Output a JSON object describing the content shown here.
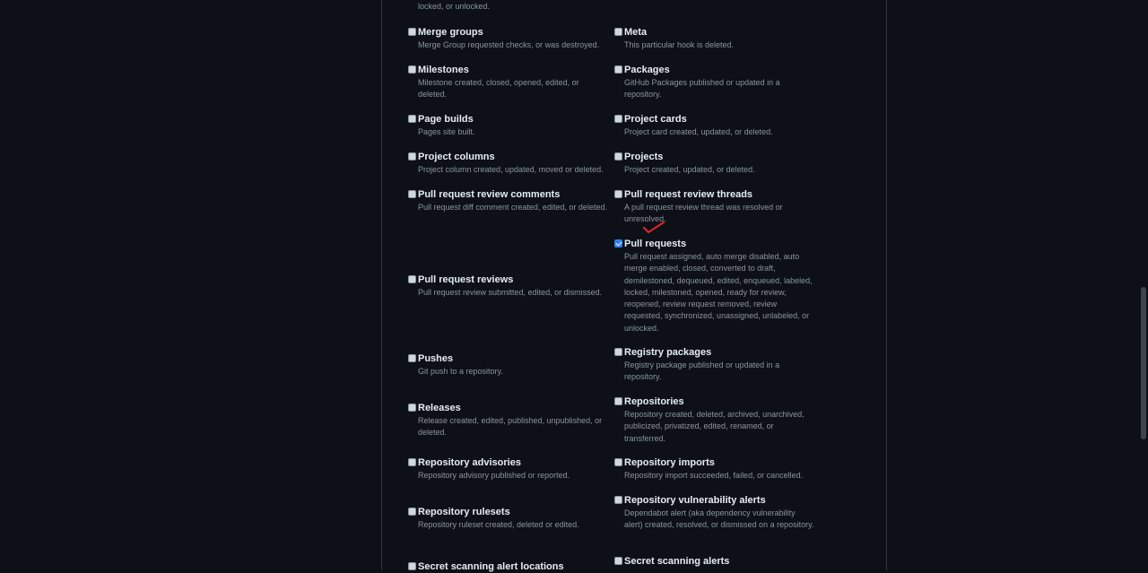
{
  "top_text": "locked, or unlocked.",
  "events": [
    {
      "title": "Merge groups",
      "desc": "Merge Group requested checks, or was destroyed.",
      "checked": false
    },
    {
      "title": "Meta",
      "desc": "This particular hook is deleted.",
      "checked": false
    },
    {
      "title": "Milestones",
      "desc": "Milestone created, closed, opened, edited, or deleted.",
      "checked": false
    },
    {
      "title": "Packages",
      "desc": "GitHub Packages published or updated in a repository.",
      "checked": false
    },
    {
      "title": "Page builds",
      "desc": "Pages site built.",
      "checked": false
    },
    {
      "title": "Project cards",
      "desc": "Project card created, updated, or deleted.",
      "checked": false
    },
    {
      "title": "Project columns",
      "desc": "Project column created, updated, moved or deleted.",
      "checked": false
    },
    {
      "title": "Projects",
      "desc": "Project created, updated, or deleted.",
      "checked": false
    },
    {
      "title": "Pull request review comments",
      "desc": "Pull request diff comment created, edited, or deleted.",
      "checked": false
    },
    {
      "title": "Pull request review threads",
      "desc": "A pull request review thread was resolved or unresolved.",
      "checked": false
    },
    {
      "title": "Pull requests",
      "desc": "Pull request assigned, auto merge disabled, auto merge enabled, closed, converted to draft, demilestoned, dequeued, edited, enqueued, labeled, locked, milestoned, opened, ready for review, reopened, review request removed, review requested, synchronized, unassigned, unlabeled, or unlocked.",
      "checked": true
    },
    {
      "title": "Pull request reviews",
      "desc": "Pull request review submitted, edited, or dismissed.",
      "checked": false
    },
    {
      "title": "Pushes",
      "desc": "Git push to a repository.",
      "checked": false
    },
    {
      "title": "Registry packages",
      "desc": "Registry package published or updated in a repository.",
      "checked": false
    },
    {
      "title": "Releases",
      "desc": "Release created, edited, published, unpublished, or deleted.",
      "checked": false
    },
    {
      "title": "Repositories",
      "desc": "Repository created, deleted, archived, unarchived, publicized, privatized, edited, renamed, or transferred.",
      "checked": false
    },
    {
      "title": "Repository advisories",
      "desc": "Repository advisory published or reported.",
      "checked": false
    },
    {
      "title": "Repository imports",
      "desc": "Repository import succeeded, failed, or cancelled.",
      "checked": false
    },
    {
      "title": "Repository rulesets",
      "desc": "Repository ruleset created, deleted or edited.",
      "checked": false
    },
    {
      "title": "Repository vulnerability alerts",
      "desc": "Dependabot alert (aka dependency vulnerability alert) created, resolved, or dismissed on a repository.",
      "checked": false
    },
    {
      "title": "Secret scanning alert locations",
      "desc": "",
      "checked": false
    },
    {
      "title": "Secret scanning alerts",
      "desc": "",
      "checked": false
    }
  ],
  "annotation_color": "#e5262c"
}
